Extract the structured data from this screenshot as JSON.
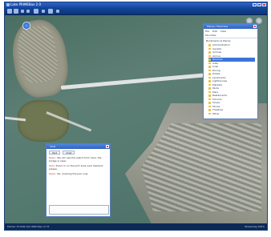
{
  "window": {
    "title": "Lake PRIMEBox 2.0"
  },
  "places_panel": {
    "title": "Places / Favorites",
    "menu": [
      "File",
      "Edit",
      "View"
    ],
    "toolbar_label": "Favorites",
    "root": "Bookmarks & Places",
    "items": [
      "Administration",
      "Aquatic",
      "Airlines",
      "Alcove",
      "Beaches",
      "Cafe",
      "Crab",
      "Dining",
      "Hotels",
      "Landmarks",
      "Lighthouses",
      "Markets",
      "Parks",
      "Piers",
      "Restaurants",
      "Schools",
      "Shops",
      "Stores",
      "Theatres",
      "Other"
    ],
    "selected_index": 4
  },
  "chat_window": {
    "title": "Chat",
    "tabs": [
      "Text",
      "Chat"
    ],
    "messages": [
      {
        "who": "Kevin",
        "text": "We can see the island from here, the bridge is clear."
      },
      {
        "who": "Sam",
        "text": "Zoom in on the port area near Oakland please."
      },
      {
        "who": "Kevin",
        "text": "Ok, marking the pier now."
      }
    ]
  },
  "status": {
    "left": "Pointer 37.81N 122.36W  Elev 17 ft",
    "right": "Streaming 100%"
  },
  "colors": {
    "titlebar": "#2f62be",
    "selected_item": "#3b74d8",
    "water": "#557a70"
  }
}
